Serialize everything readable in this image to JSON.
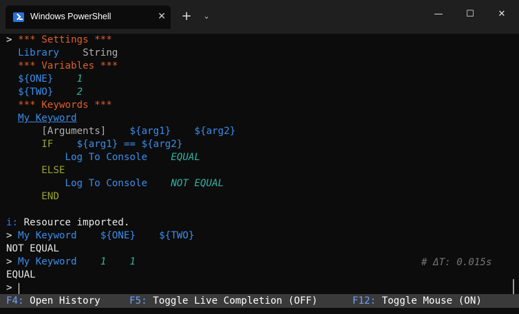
{
  "window": {
    "tab_title": "Windows PowerShell",
    "tab_close": "✕",
    "new_tab": "+",
    "dropdown": "⌄",
    "minimize": "—",
    "maximize": "☐",
    "close": "✕"
  },
  "terminal": {
    "prompt": ">",
    "settings_header": "*** Settings ***",
    "library_kw": "Library",
    "library_val": "String",
    "variables_header": "*** Variables ***",
    "var1_name": "${ONE}",
    "var1_val": "1",
    "var2_name": "${TWO}",
    "var2_val": "2",
    "keywords_header": "*** Keywords ***",
    "keyword_name": "My Keyword",
    "arguments_tag": "[Arguments]",
    "arg1": "${arg1}",
    "arg2": "${arg2}",
    "if_kw": "IF",
    "condition": "${arg1} == ${arg2}",
    "log_kw": "Log To Console",
    "equal_val": "EQUAL",
    "else_kw": "ELSE",
    "not_equal_val": "NOT EQUAL",
    "end_kw": "END",
    "info_prefix": "i:",
    "info_msg": "Resource imported.",
    "call1_kw": "My Keyword",
    "call1_arg1": "${ONE}",
    "call1_arg2": "${TWO}",
    "out1": "NOT EQUAL",
    "call2_kw": "My Keyword",
    "call2_arg1": "1",
    "call2_arg2": "1",
    "timing": "# ΔT: 0.015s",
    "out2": "EQUAL"
  },
  "statusbar": {
    "f4_key": "F4:",
    "f4_label": "Open History",
    "f5_key": "F5:",
    "f5_label": "Toggle Live Completion (OFF)",
    "f12_key": "F12:",
    "f12_label": "Toggle Mouse (ON)"
  }
}
